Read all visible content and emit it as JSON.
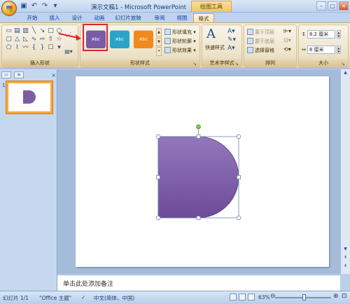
{
  "window": {
    "title": "演示文稿1 - Microsoft PowerPoint",
    "contextual_tab": "绘图工具",
    "qat_icons": [
      "save-icon",
      "undo-icon",
      "redo-icon",
      "customize-icon"
    ]
  },
  "tabs": [
    "开始",
    "插入",
    "设计",
    "动画",
    "幻灯片放映",
    "审阅",
    "视图",
    "格式"
  ],
  "active_tab": "格式",
  "ribbon": {
    "insert_shapes": {
      "label": "插入形状"
    },
    "shape_styles": {
      "label": "形状样式",
      "swatches": [
        {
          "text": "Abc",
          "color": "#7b5aa6"
        },
        {
          "text": "Abc",
          "color": "#2aa3c9"
        },
        {
          "text": "Abc",
          "color": "#f08a1c"
        }
      ],
      "fill": "形状填充 ▾",
      "outline": "形状轮廓 ▾",
      "effects": "形状效果 ▾"
    },
    "wordart": {
      "label": "艺术字样式",
      "quick_styles": "快速样式"
    },
    "arrange": {
      "label": "排列",
      "bring_front": "置于顶层",
      "send_back": "置于底层",
      "selection_pane": "选择窗格"
    },
    "size": {
      "label": "大小",
      "height": "8.2 厘米",
      "width": "8 厘米"
    }
  },
  "notes_placeholder": "单击此处添加备注",
  "status": {
    "slide_counter": "幻灯片 1/1",
    "theme": "\"Office 主题\"",
    "language": "中文(简体，中国)",
    "zoom": "63%"
  },
  "colors": {
    "shape_fill": "#7b5aa6",
    "shape_highlight": "#9377bc",
    "selection_border": "#e3242b"
  }
}
